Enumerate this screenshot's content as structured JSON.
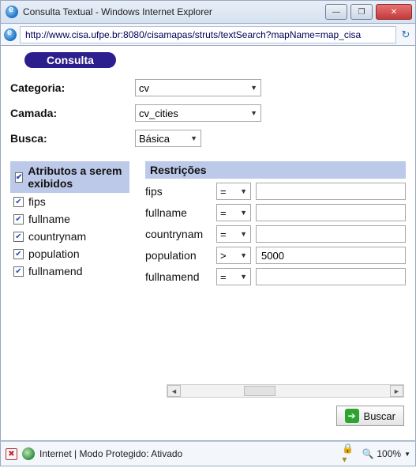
{
  "window": {
    "title": "Consulta Textual - Windows Internet Explorer",
    "url": "http://www.cisa.ufpe.br:8080/cisamapas/struts/textSearch?mapName=map_cisa"
  },
  "panel": {
    "title": "Consulta"
  },
  "form": {
    "categoria": {
      "label": "Categoria:",
      "value": "cv"
    },
    "camada": {
      "label": "Camada:",
      "value": "cv_cities"
    },
    "busca": {
      "label": "Busca:",
      "value": "Básica"
    }
  },
  "attributes": {
    "title": "Atributos a serem exibidos",
    "items": [
      {
        "name": "fips",
        "checked": true
      },
      {
        "name": "fullname",
        "checked": true
      },
      {
        "name": "countrynam",
        "checked": true
      },
      {
        "name": "population",
        "checked": true
      },
      {
        "name": "fullnamend",
        "checked": true
      }
    ]
  },
  "restrictions": {
    "title": "Restrições",
    "rows": [
      {
        "name": "fips",
        "op": "=",
        "value": ""
      },
      {
        "name": "fullname",
        "op": "=",
        "value": ""
      },
      {
        "name": "countrynam",
        "op": "=",
        "value": ""
      },
      {
        "name": "population",
        "op": ">",
        "value": "5000"
      },
      {
        "name": "fullnamend",
        "op": "=",
        "value": ""
      }
    ]
  },
  "buttons": {
    "buscar": "Buscar"
  },
  "status": {
    "text": "Internet | Modo Protegido: Ativado",
    "zoom": "100%"
  }
}
